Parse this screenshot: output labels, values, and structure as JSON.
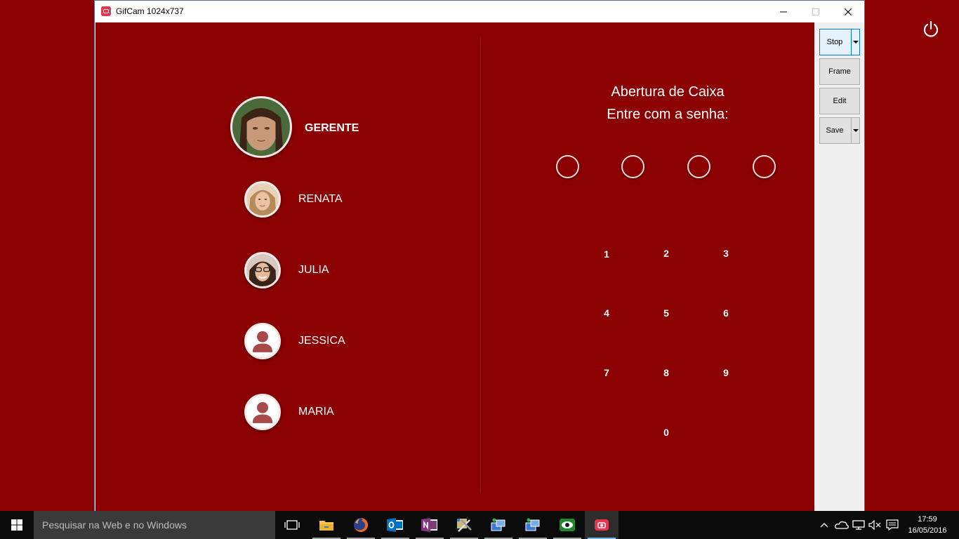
{
  "window": {
    "title": "GifCam 1024x737"
  },
  "users": [
    {
      "name": "GERENTE",
      "avatar": "photo"
    },
    {
      "name": "RENATA",
      "avatar": "photo"
    },
    {
      "name": "JULIA",
      "avatar": "photo"
    },
    {
      "name": "JESSICA",
      "avatar": "placeholder"
    },
    {
      "name": "MARIA",
      "avatar": "placeholder"
    }
  ],
  "password_panel": {
    "line1": "Abertura de Caixa",
    "line2": "Entre com a senha:",
    "pin_slots": 4,
    "keys": [
      "1",
      "2",
      "3",
      "4",
      "5",
      "6",
      "7",
      "8",
      "9",
      "0"
    ]
  },
  "side_panel": {
    "stop": "Stop",
    "frame": "Frame",
    "edit": "Edit",
    "save": "Save"
  },
  "taskbar": {
    "search_placeholder": "Pesquisar na Web e no Windows",
    "time": "17:59",
    "date": "16/05/2016",
    "apps": [
      "task-view-icon",
      "file-explorer-icon",
      "firefox-icon",
      "outlook-icon",
      "onenote-icon",
      "tools-icon",
      "network-app-icon",
      "network-app-2-icon",
      "eye-app-icon",
      "gifcam-icon"
    ]
  },
  "colors": {
    "background": "#8b0000",
    "accent": "#0078d7",
    "taskbar": "#0b0b0b"
  }
}
